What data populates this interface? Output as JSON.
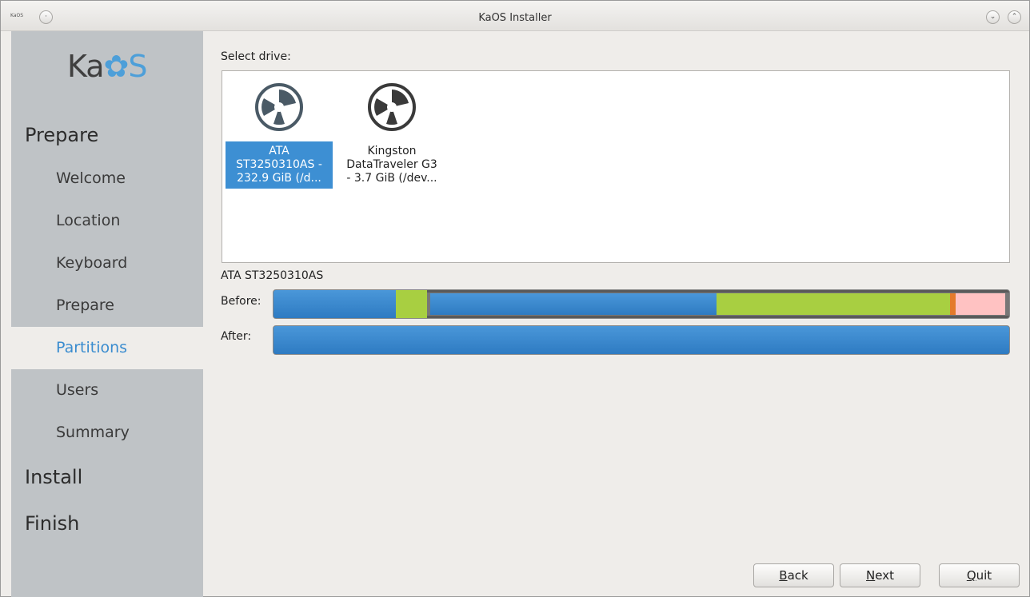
{
  "window": {
    "app_small_label": "KaOS",
    "title": "KaOS Installer",
    "btn_menu": "·",
    "btn_minimize": "⌄",
    "btn_maximize": "⌃"
  },
  "sidebar": {
    "logo_prefix": "Ka",
    "logo_gear": "✿",
    "logo_suffix": "S",
    "sections": [
      {
        "label": "Prepare"
      },
      {
        "label": "Install"
      },
      {
        "label": "Finish"
      }
    ],
    "items": [
      {
        "label": "Welcome",
        "active": false
      },
      {
        "label": "Location",
        "active": false
      },
      {
        "label": "Keyboard",
        "active": false
      },
      {
        "label": "Prepare",
        "active": false
      },
      {
        "label": "Partitions",
        "active": true
      },
      {
        "label": "Users",
        "active": false
      },
      {
        "label": "Summary",
        "active": false
      }
    ]
  },
  "main": {
    "select_drive_label": "Select drive:",
    "drives": [
      {
        "label": "ATA\nST3250310AS -\n232.9 GiB (/d...",
        "selected": true
      },
      {
        "label": "Kingston\nDataTraveler G3\n- 3.7 GiB (/dev...",
        "selected": false
      }
    ],
    "selected_drive_name": "ATA ST3250310AS",
    "before_label": "Before:",
    "after_label": "After:",
    "before_partitions": [
      {
        "type": "ntfs",
        "color": "#3d8fd3",
        "fraction": 0.166
      },
      {
        "type": "swap",
        "color": "#a8cf41",
        "fraction": 0.042
      },
      {
        "type": "ext-blue",
        "color": "#3d8fd3",
        "fraction": 0.392
      },
      {
        "type": "ext-green",
        "color": "#a8cf41",
        "fraction": 0.32
      },
      {
        "type": "ext-orange",
        "color": "#e47a2a",
        "fraction": 0.008
      },
      {
        "type": "unallocated",
        "color": "#ffc2c2",
        "fraction": 0.066
      }
    ],
    "after_partitions": [
      {
        "type": "new",
        "color": "#3d8fd3",
        "fraction": 1.0
      }
    ]
  },
  "buttons": {
    "back": {
      "accel": "B",
      "rest": "ack"
    },
    "next": {
      "accel": "N",
      "rest": "ext"
    },
    "quit": {
      "accel": "Q",
      "rest": "uit"
    }
  }
}
